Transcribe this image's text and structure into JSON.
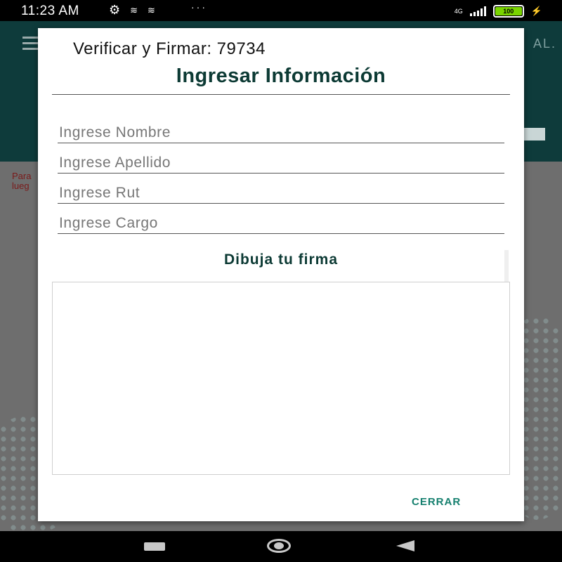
{
  "status_bar": {
    "time": "11:23 AM",
    "overflow": "···",
    "network": "4G",
    "battery": "100",
    "battery_level": 1.0,
    "icons": [
      "settings-icon",
      "notification-icon",
      "notification-icon",
      "signal-icon",
      "battery-icon",
      "charging-icon"
    ]
  },
  "background": {
    "text_line1": "Para",
    "text_line2": "lueg",
    "logo": "AL."
  },
  "dialog": {
    "title": "Verificar y Firmar: 79734",
    "heading": "Ingresar Información",
    "fields": {
      "nombre_placeholder": "Ingrese Nombre",
      "apellido_placeholder": "Ingrese Apellido",
      "rut_placeholder": "Ingrese Rut",
      "cargo_placeholder": "Ingrese Cargo"
    },
    "signature_label": "Dibuja tu firma",
    "close_label": "CERRAR"
  },
  "colors": {
    "accent": "#16806f",
    "heading": "#0c3a34",
    "header_bg": "#0e3b3b"
  }
}
